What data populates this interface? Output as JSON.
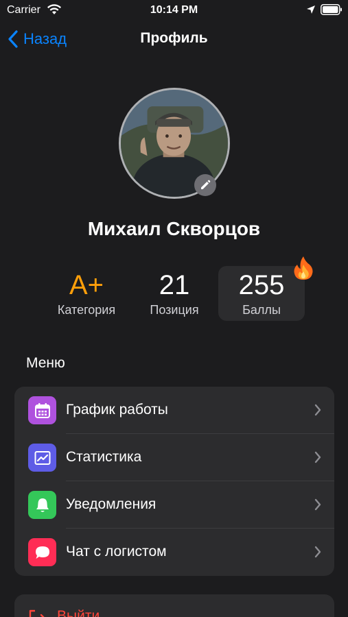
{
  "status_bar": {
    "carrier": "Carrier",
    "time": "10:14 PM",
    "icons": [
      "wifi-icon",
      "location-arrow-icon",
      "battery-icon"
    ]
  },
  "nav": {
    "back_label": "Назад",
    "title": "Профиль"
  },
  "profile": {
    "name": "Михаил Скворцов",
    "avatar": "user-photo",
    "edit_icon": "pencil-icon"
  },
  "stats": [
    {
      "value": "A+",
      "label": "Категория",
      "color": "#ff9f0a"
    },
    {
      "value": "21",
      "label": "Позиция"
    },
    {
      "value": "255",
      "label": "Баллы",
      "badge_icon": "fire-icon"
    }
  ],
  "menu": {
    "heading": "Меню",
    "items": [
      {
        "label": "График работы",
        "icon": "calendar-icon",
        "color": "#af52de"
      },
      {
        "label": "Статистика",
        "icon": "chart-icon",
        "color": "#5e5ce6"
      },
      {
        "label": "Уведомления",
        "icon": "bell-icon",
        "color": "#34c759"
      },
      {
        "label": "Чат с логистом",
        "icon": "chat-bubble-icon",
        "color": "#ff2d55"
      }
    ]
  },
  "logout": {
    "label": "Выйти",
    "icon": "logout-icon",
    "color": "#ff453a"
  },
  "colors": {
    "background": "#1c1c1e",
    "card": "#2c2c2e",
    "accent": "#0a84ff"
  }
}
